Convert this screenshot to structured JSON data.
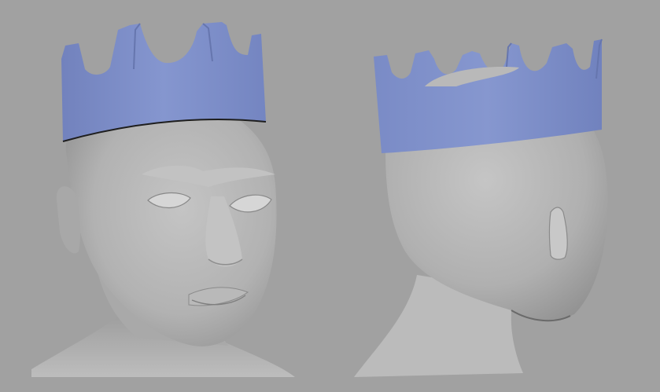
{
  "scene": {
    "background_color": "#a1a1a1",
    "skin_color": "#b8b8b8",
    "crown_color": "#7f90c7"
  },
  "viewports": [
    {
      "id": "front-three-quarter"
    },
    {
      "id": "back-three-quarter"
    }
  ]
}
